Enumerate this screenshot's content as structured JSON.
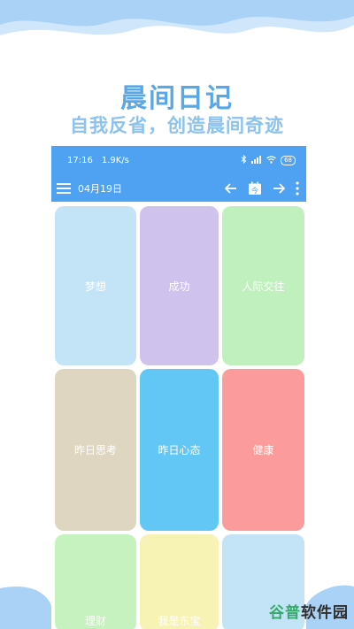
{
  "promo": {
    "title": "晨间日记",
    "subtitle": "自我反省，创造晨间奇迹"
  },
  "statusbar": {
    "time": "17:16",
    "speed": "1.9K/s",
    "battery": "68"
  },
  "toolbar": {
    "date": "04月19日",
    "today_label": "今"
  },
  "tiles": [
    {
      "label": "梦想",
      "color": "#c3e4f7"
    },
    {
      "label": "成功",
      "color": "#cfc3ee"
    },
    {
      "label": "人际交往",
      "color": "#bff0bd"
    },
    {
      "label": "昨日思考",
      "color": "#ded6c1"
    },
    {
      "label": "昨日心态",
      "color": "#63c7f5"
    },
    {
      "label": "健康",
      "color": "#fb9b9b"
    },
    {
      "label": "理财",
      "color": "#c6f2bf"
    },
    {
      "label": "我是东宝",
      "color": "#f7f3b4"
    },
    {
      "label": "",
      "color": "#c3e4f7"
    }
  ],
  "watermark": {
    "part1": "谷普",
    "part2": "软件园"
  },
  "colors": {
    "accent": "#4fa1f2",
    "title": "#5aa7e6",
    "subtitle": "#8cc2ee"
  }
}
